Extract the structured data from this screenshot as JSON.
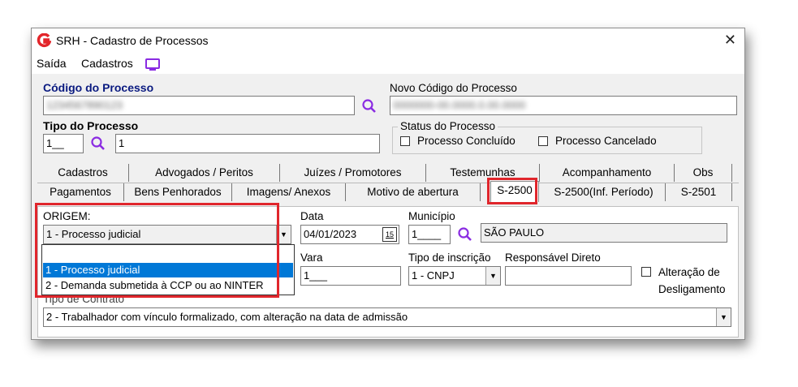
{
  "window": {
    "title": "SRH - Cadastro de Processos",
    "close": "✕"
  },
  "menu": {
    "saida": "Saída",
    "cadastros": "Cadastros"
  },
  "process": {
    "codigo_label": "Código do Processo",
    "codigo_value": "1234567890123",
    "novo_codigo_label": "Novo Código do Processo",
    "novo_codigo_value": "0000000-00.0000.0.00.0000",
    "tipo_label": "Tipo do Processo",
    "tipo_code": "1__",
    "tipo_desc": "1",
    "status_label": "Status do Processo",
    "concluido_label": "Processo Concluído",
    "cancelado_label": "Processo Cancelado"
  },
  "tabs_row1": [
    "Cadastros",
    "Advogados / Peritos",
    "Juízes / Promotores",
    "Testemunhas",
    "Acompanhamento",
    "Obs"
  ],
  "tabs_row2": [
    "Pagamentos",
    "Bens Penhorados",
    "Imagens/ Anexos",
    "Motivo de abertura",
    "S-2500",
    "S-2500(Inf. Período)",
    "S-2501"
  ],
  "form": {
    "origem_label": "ORIGEM:",
    "origem_value": "1 - Processo judicial",
    "origem_options": [
      "1 - Processo judicial",
      "2 - Demanda submetida à CCP ou ao NINTER"
    ],
    "data_label": "Data",
    "data_value": "04/01/2023",
    "calendar_label": "15",
    "municipio_label": "Município",
    "municipio_code": "1____",
    "municipio_value": "SÃO PAULO",
    "vara_label": "Vara",
    "vara_value": "1___",
    "tipo_inscricao_label": "Tipo de inscrição",
    "tipo_inscricao_value": "1 - CNPJ",
    "responsavel_label": "Responsável Direto",
    "alteracao_label_1": "Alteração de",
    "alteracao_label_2": "Desligamento",
    "tipo_contrato_label": "Tipo de Contrato",
    "tipo_contrato_value": "2 - Trabalhador com vínculo formalizado, com alteração na data de admissão"
  },
  "colors": {
    "highlight_red": "#e0262c",
    "selection_blue": "#0078d7",
    "brand_red": "#e3262b",
    "icon_purple": "#8a2be2"
  }
}
